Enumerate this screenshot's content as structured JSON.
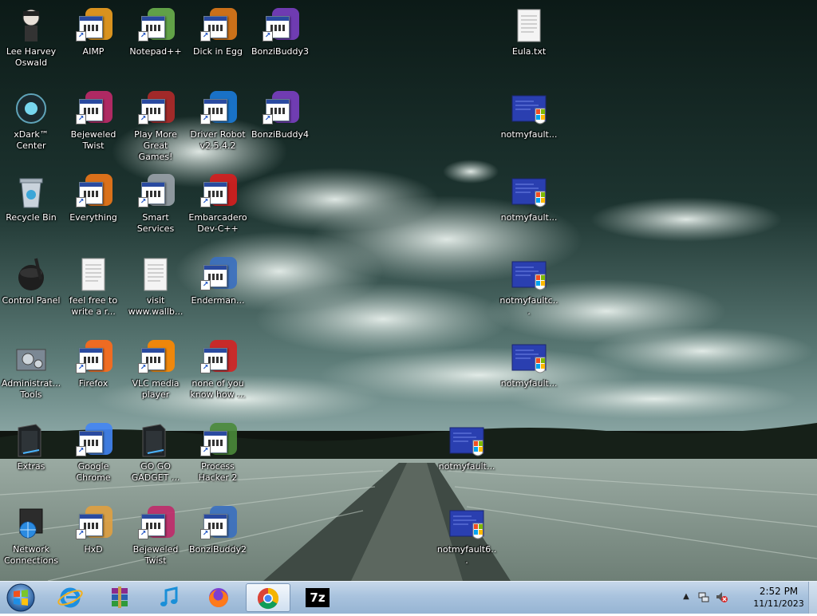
{
  "desktop": {
    "icons": [
      {
        "label": "Lee Harvey Oswald",
        "icon": "person-figure-icon"
      },
      {
        "label": "AIMP",
        "icon": "aimp-icon"
      },
      {
        "label": "Notepad++",
        "icon": "notepad-plus-plus-icon"
      },
      {
        "label": "Dick in Egg",
        "icon": "egg-app-icon"
      },
      {
        "label": "BonziBuddy3",
        "icon": "purple-gorilla-icon"
      },
      {
        "label": "Eula.txt",
        "icon": "text-document-icon"
      },
      {
        "label": "xDark™ Center",
        "icon": "dark-orb-icon"
      },
      {
        "label": "Bejeweled Twist",
        "icon": "bejeweled-icon"
      },
      {
        "label": "Play More Great Games!",
        "icon": "games-disc-icon"
      },
      {
        "label": "Driver Robot v2.5.4.2",
        "icon": "driver-robot-icon"
      },
      {
        "label": "BonziBuddy4",
        "icon": "purple-gorilla-icon"
      },
      {
        "label": "notmyfault...",
        "icon": "crash-tool-icon"
      },
      {
        "label": "Recycle Bin",
        "icon": "recycle-bin-icon"
      },
      {
        "label": "Everything",
        "icon": "search-ring-icon"
      },
      {
        "label": "Smart Services",
        "icon": "gear-icon"
      },
      {
        "label": "Embarcadero Dev-C++",
        "icon": "devcpp-icon"
      },
      {
        "label": "notmyfault...",
        "icon": "crash-tool-icon"
      },
      {
        "label": "Control Panel",
        "icon": "control-panel-icon"
      },
      {
        "label": "feel free to write a r...",
        "icon": "text-document-icon"
      },
      {
        "label": "visit www.wallb...",
        "icon": "text-document-icon"
      },
      {
        "label": "Enderman...",
        "icon": "application-window-icon"
      },
      {
        "label": "notmyfaultc...",
        "icon": "crash-tool-icon"
      },
      {
        "label": "Administrat... Tools",
        "icon": "admin-tools-icon"
      },
      {
        "label": "Firefox",
        "icon": "firefox-icon"
      },
      {
        "label": "VLC media player",
        "icon": "vlc-cone-icon"
      },
      {
        "label": "none of you know how ...",
        "icon": "red-swirl-icon"
      },
      {
        "label": "notmyfault...",
        "icon": "crash-tool-icon"
      },
      {
        "label": "Extras",
        "icon": "folder-dark-icon"
      },
      {
        "label": "Google Chrome",
        "icon": "chrome-icon"
      },
      {
        "label": "GO GO GADGET ...",
        "icon": "folder-dark-icon"
      },
      {
        "label": "Process Hacker 2",
        "icon": "process-hacker-icon"
      },
      {
        "label": "notmyfault...",
        "icon": "crash-tool-icon"
      },
      {
        "label": "Network Connections",
        "icon": "network-globe-icon"
      },
      {
        "label": "HxD",
        "icon": "hxd-icon"
      },
      {
        "label": "Bejeweled Twist",
        "icon": "bejeweled-icon"
      },
      {
        "label": "BonziBuddy2",
        "icon": "application-window-icon"
      },
      {
        "label": "notmyfault6...",
        "icon": "crash-tool-icon"
      }
    ]
  },
  "taskbar": {
    "start_icon": "windows-orb-icon",
    "pinned": [
      {
        "name": "Internet Explorer",
        "icon": "internet-explorer-icon"
      },
      {
        "name": "WinRAR",
        "icon": "winrar-icon"
      },
      {
        "name": "iTunes",
        "icon": "music-note-icon"
      },
      {
        "name": "Firefox",
        "icon": "firefox-icon"
      },
      {
        "name": "Google Chrome",
        "icon": "chrome-icon",
        "active": true
      },
      {
        "name": "7-Zip",
        "icon": "seven-zip-icon",
        "text": "7z"
      }
    ],
    "tray": {
      "time": "2:52 PM",
      "date": "11/11/2023",
      "icons": [
        "show-hidden-icons-icon",
        "network-icon",
        "volume-muted-icon"
      ]
    }
  },
  "colors": {
    "taskbar": "#a9c3de",
    "sky_dark": "#0f1f1c",
    "field": "#8d9e95"
  }
}
